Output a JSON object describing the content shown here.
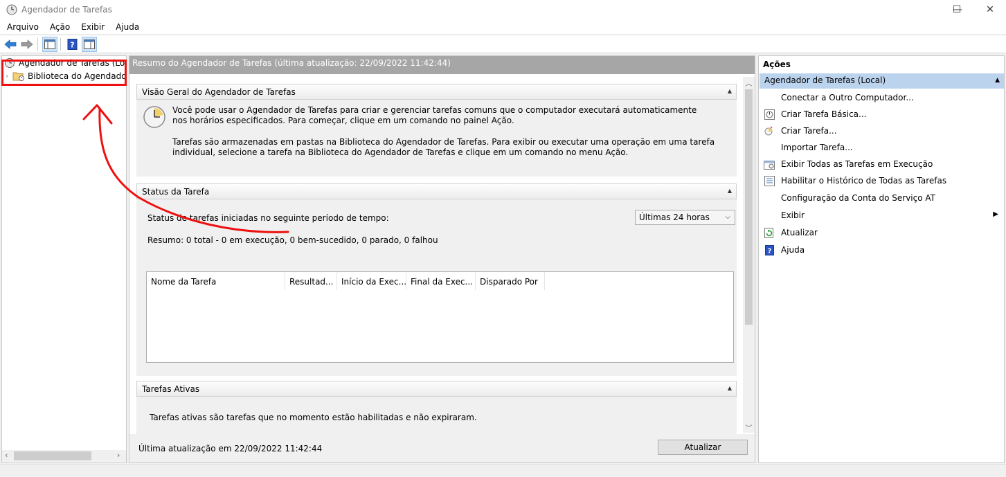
{
  "window": {
    "title": "Agendador de Tarefas",
    "minimize": "—",
    "maximize": "☐",
    "close": "✕"
  },
  "menu": [
    "Arquivo",
    "Ação",
    "Exibir",
    "Ajuda"
  ],
  "tree": {
    "root": "Agendador de Tarefas (Local)",
    "library": "Biblioteca do Agendador"
  },
  "center": {
    "header": "Resumo do Agendador de Tarefas (última atualização: 22/09/2022 11:42:44)",
    "overview": {
      "title": "Visão Geral do Agendador de Tarefas",
      "p1": "Você pode usar o Agendador de Tarefas para criar e gerenciar tarefas comuns que o computador executará automaticamente nos horários especificados. Para começar, clique em um comando no painel Ação.",
      "p2": "Tarefas são armazenadas em pastas na Biblioteca do Agendador de Tarefas. Para exibir ou executar uma operação em uma tarefa individual, selecione a tarefa na Biblioteca do Agendador de Tarefas e clique em um comando no menu Ação."
    },
    "status": {
      "title": "Status da Tarefa",
      "period_label": "Status de tarefas iniciadas no seguinte período de tempo:",
      "period_value": "Últimas 24 horas",
      "summary": "Resumo: 0 total - 0 em execução, 0 bem-sucedido, 0 parado, 0 falhou",
      "columns": [
        "Nome da Tarefa",
        "Resultad...",
        "Início da Exec...",
        "Final da Exec...",
        "Disparado Por"
      ]
    },
    "active": {
      "title": "Tarefas Ativas",
      "text": "Tarefas ativas são tarefas que no momento estão habilitadas e não expiraram."
    },
    "footer": {
      "last_update": "Última atualização em 22/09/2022 11:42:44",
      "refresh": "Atualizar"
    }
  },
  "actions": {
    "title": "Ações",
    "group": "Agendador de Tarefas (Local)",
    "items": [
      {
        "label": "Conectar a Outro Computador...",
        "icon": "none"
      },
      {
        "label": "Criar Tarefa Básica...",
        "icon": "basic-task-icon"
      },
      {
        "label": "Criar Tarefa...",
        "icon": "create-task-icon"
      },
      {
        "label": "Importar Tarefa...",
        "icon": "none"
      },
      {
        "label": "Exibir Todas as Tarefas em Execução",
        "icon": "running-tasks-icon"
      },
      {
        "label": "Habilitar o Histórico de Todas as Tarefas",
        "icon": "history-icon"
      },
      {
        "label": "Configuração da Conta do Serviço AT",
        "icon": "none"
      },
      {
        "label": "Exibir",
        "icon": "none",
        "submenu": true
      },
      {
        "label": "Atualizar",
        "icon": "refresh-icon"
      },
      {
        "label": "Ajuda",
        "icon": "help-icon"
      }
    ]
  },
  "colors": {
    "annotation": "#e11",
    "selection": "#bcd3ee",
    "header_gray": "#a6a6a6"
  }
}
